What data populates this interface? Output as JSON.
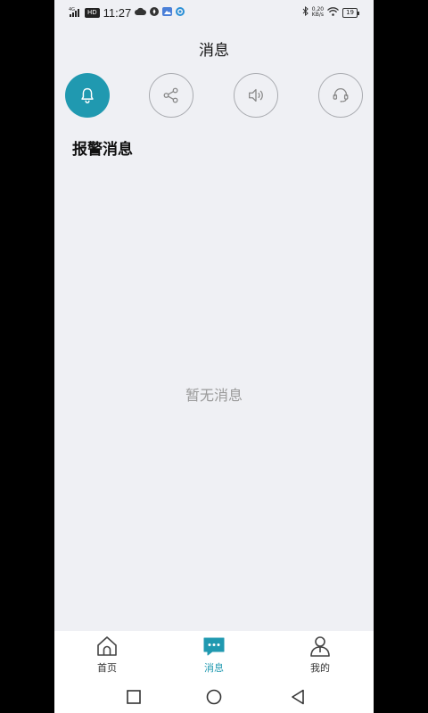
{
  "status_bar": {
    "network": "4G",
    "hd": "HD",
    "time": "11:27",
    "speed_value": "0.20",
    "speed_unit": "KB/s",
    "battery": "19"
  },
  "header": {
    "title": "消息"
  },
  "categories": [
    {
      "icon": "bell-icon",
      "active": true
    },
    {
      "icon": "share-icon",
      "active": false
    },
    {
      "icon": "speaker-icon",
      "active": false
    },
    {
      "icon": "headset-icon",
      "active": false
    }
  ],
  "section": {
    "title": "报警消息"
  },
  "empty_state": {
    "text": "暂无消息"
  },
  "bottom_nav": {
    "items": [
      {
        "label": "首页",
        "icon": "home-icon",
        "active": false
      },
      {
        "label": "消息",
        "icon": "chat-icon",
        "active": true
      },
      {
        "label": "我的",
        "icon": "user-icon",
        "active": false
      }
    ]
  },
  "colors": {
    "accent": "#2099b0",
    "background": "#eff0f4",
    "muted_text": "#9a9a9a"
  }
}
